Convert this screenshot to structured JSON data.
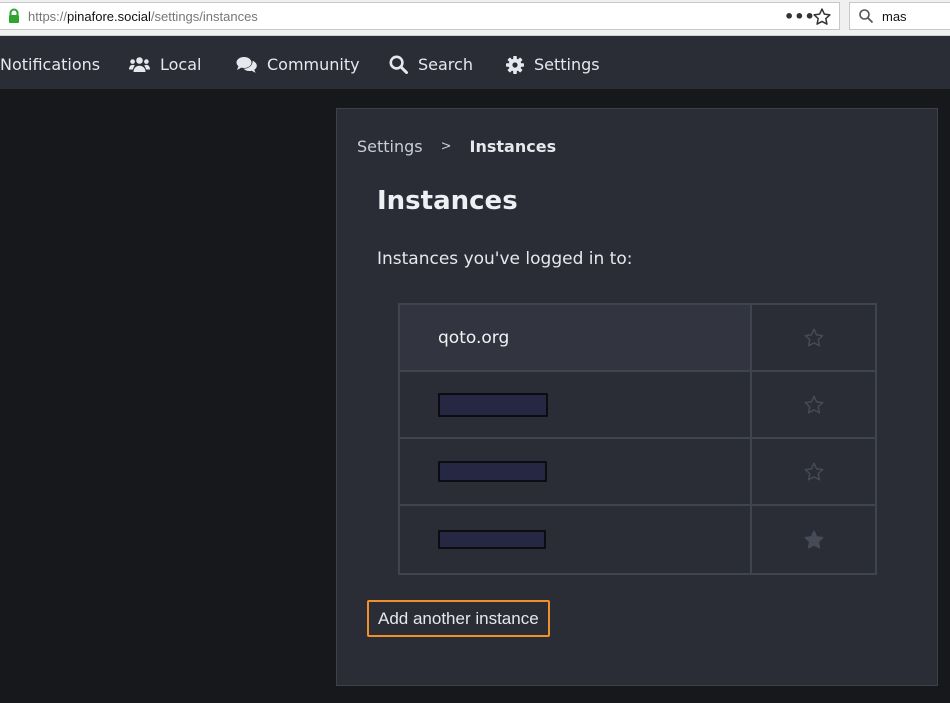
{
  "browser": {
    "url_prefix": "https://",
    "url_host": "pinafore.social",
    "url_path": "/settings/instances",
    "menu_dots": "•••",
    "search_value": "mas"
  },
  "nav": {
    "items": [
      {
        "label": "Notifications",
        "icon": "bell-icon"
      },
      {
        "label": "Local",
        "icon": "users-icon"
      },
      {
        "label": "Community",
        "icon": "comments-icon"
      },
      {
        "label": "Search",
        "icon": "search-icon"
      },
      {
        "label": "Settings",
        "icon": "gear-icon"
      }
    ]
  },
  "breadcrumb": {
    "parent": "Settings",
    "separator": ">",
    "current": "Instances"
  },
  "page": {
    "title": "Instances",
    "subtitle": "Instances you've logged in to:",
    "add_button": "Add another instance"
  },
  "instances": [
    {
      "name": "qoto.org",
      "redacted": false,
      "favorite": false,
      "selected": true
    },
    {
      "name": "",
      "redacted": true,
      "favorite": false,
      "selected": false
    },
    {
      "name": "",
      "redacted": true,
      "favorite": false,
      "selected": false
    },
    {
      "name": "",
      "redacted": true,
      "favorite": true,
      "selected": false
    }
  ],
  "colors": {
    "accent": "#f0902a",
    "lock": "#2fa52f",
    "background": "#17181c",
    "panel": "#2a2d36"
  }
}
